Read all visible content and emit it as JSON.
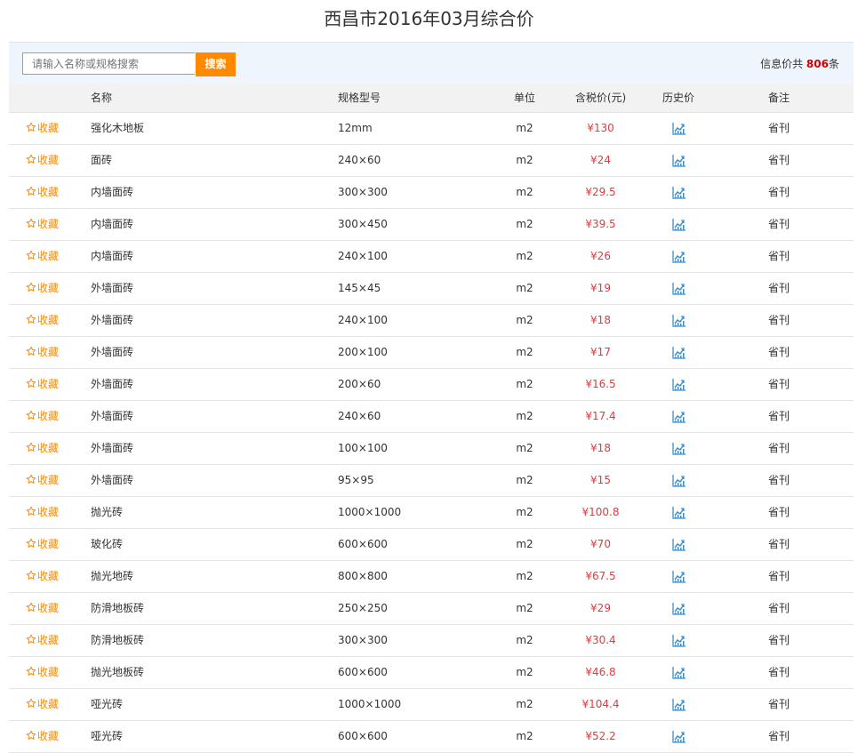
{
  "page": {
    "title": "西昌市2016年03月综合价"
  },
  "search": {
    "placeholder": "请输入名称或规格搜索",
    "button_label": "搜索"
  },
  "info": {
    "prefix": "信息价共",
    "count": "806",
    "suffix": "条"
  },
  "table": {
    "headers": {
      "name": "名称",
      "spec": "规格型号",
      "unit": "单位",
      "price": "含税价(元)",
      "history": "历史价",
      "note": "备注"
    },
    "fav_label": "收藏",
    "rows": [
      {
        "name": "强化木地板",
        "spec": "12mm",
        "unit": "m2",
        "price": "¥130",
        "note": "省刊"
      },
      {
        "name": "面砖",
        "spec": "240×60",
        "unit": "m2",
        "price": "¥24",
        "note": "省刊"
      },
      {
        "name": "内墙面砖",
        "spec": "300×300",
        "unit": "m2",
        "price": "¥29.5",
        "note": "省刊"
      },
      {
        "name": "内墙面砖",
        "spec": "300×450",
        "unit": "m2",
        "price": "¥39.5",
        "note": "省刊"
      },
      {
        "name": "内墙面砖",
        "spec": "240×100",
        "unit": "m2",
        "price": "¥26",
        "note": "省刊"
      },
      {
        "name": "外墙面砖",
        "spec": "145×45",
        "unit": "m2",
        "price": "¥19",
        "note": "省刊"
      },
      {
        "name": "外墙面砖",
        "spec": "240×100",
        "unit": "m2",
        "price": "¥18",
        "note": "省刊"
      },
      {
        "name": "外墙面砖",
        "spec": "200×100",
        "unit": "m2",
        "price": "¥17",
        "note": "省刊"
      },
      {
        "name": "外墙面砖",
        "spec": "200×60",
        "unit": "m2",
        "price": "¥16.5",
        "note": "省刊"
      },
      {
        "name": "外墙面砖",
        "spec": "240×60",
        "unit": "m2",
        "price": "¥17.4",
        "note": "省刊"
      },
      {
        "name": "外墙面砖",
        "spec": "100×100",
        "unit": "m2",
        "price": "¥18",
        "note": "省刊"
      },
      {
        "name": "外墙面砖",
        "spec": "95×95",
        "unit": "m2",
        "price": "¥15",
        "note": "省刊"
      },
      {
        "name": "抛光砖",
        "spec": "1000×1000",
        "unit": "m2",
        "price": "¥100.8",
        "note": "省刊"
      },
      {
        "name": "玻化砖",
        "spec": "600×600",
        "unit": "m2",
        "price": "¥70",
        "note": "省刊"
      },
      {
        "name": "抛光地砖",
        "spec": "800×800",
        "unit": "m2",
        "price": "¥67.5",
        "note": "省刊"
      },
      {
        "name": "防滑地板砖",
        "spec": "250×250",
        "unit": "m2",
        "price": "¥29",
        "note": "省刊"
      },
      {
        "name": "防滑地板砖",
        "spec": "300×300",
        "unit": "m2",
        "price": "¥30.4",
        "note": "省刊"
      },
      {
        "name": "抛光地板砖",
        "spec": "600×600",
        "unit": "m2",
        "price": "¥46.8",
        "note": "省刊"
      },
      {
        "name": "哑光砖",
        "spec": "1000×1000",
        "unit": "m2",
        "price": "¥104.4",
        "note": "省刊"
      },
      {
        "name": "哑光砖",
        "spec": "600×600",
        "unit": "m2",
        "price": "¥52.2",
        "note": "省刊"
      }
    ]
  },
  "icons": {
    "fav": "star-outline-icon",
    "history": "trend-chart-icon"
  },
  "colors": {
    "accent": "#ff8a00",
    "price": "#e4393c",
    "header_bg": "#f2f2f2",
    "search_bg": "#eef5fd",
    "icon_blue": "#3a8fd0"
  }
}
